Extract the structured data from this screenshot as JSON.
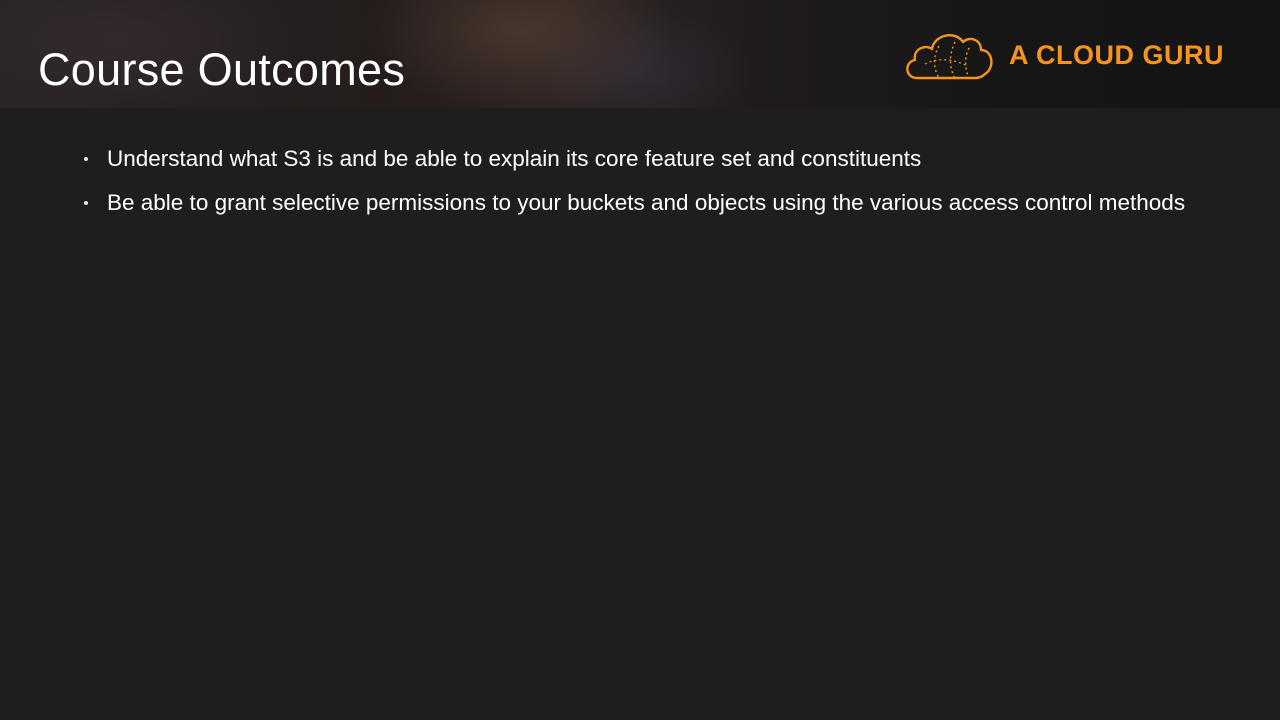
{
  "slide": {
    "title": "Course Outcomes",
    "brand": {
      "logo_icon": "cloud-icon",
      "name": "A CLOUD GURU",
      "color": "#f7941e"
    },
    "bullets": [
      {
        "text": "Understand what S3 is and be able to explain its core feature set and constituents"
      },
      {
        "text": "Be able to grant selective permissions to your buckets and objects using the various access control methods"
      }
    ]
  }
}
